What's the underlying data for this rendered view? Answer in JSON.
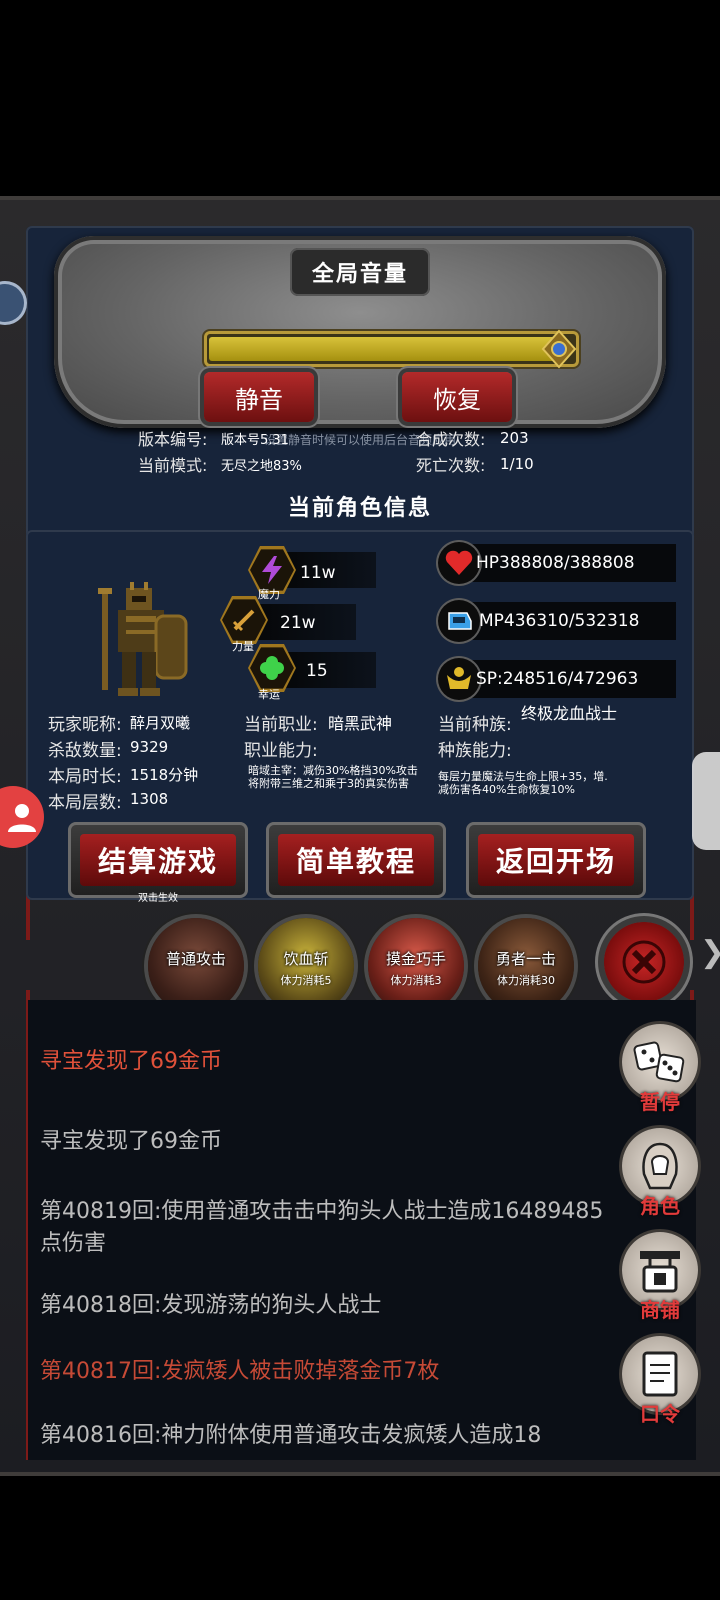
{
  "settings": {
    "title": "全局音量",
    "volume_level": 0.96,
    "mute_label": "静音",
    "restore_label": "恢复",
    "hint": "设置静音时候可以使用后台音频应用",
    "version_label": "版本编号:",
    "version_value": "版本号5.31",
    "mode_label": "当前模式:",
    "mode_value": "无尽之地83%",
    "synth_label": "合成次数:",
    "synth_value": "203",
    "death_label": "死亡次数:",
    "death_value": "1/10"
  },
  "character": {
    "title": "当前角色信息",
    "magic": {
      "value": "11w",
      "tag": "魔力",
      "icon": "lightning-icon"
    },
    "strength": {
      "value": "21w",
      "tag": "力量",
      "icon": "sword-icon"
    },
    "luck": {
      "value": "15",
      "tag": "幸运",
      "icon": "clover-icon"
    },
    "hp": "HP388808/388808",
    "mp": "MP436310/532318",
    "sp": "SP:248516/472963",
    "nickname_label": "玩家昵称:",
    "nickname": "醉月双曦",
    "kills_label": "杀敌数量:",
    "kills": "9329",
    "time_label": "本局时长:",
    "time": "1518分钟",
    "floor_label": "本局层数:",
    "floor": "1308",
    "job_label": "当前职业:",
    "job": "暗黑武神",
    "job_ability_label": "职业能力:",
    "job_ability": "暗域主宰：减伤30%格挡30%攻击将附带三维之和乘于3的真实伤害",
    "race_label": "当前种族:",
    "race": "终极龙血战士",
    "race_ability_label": "种族能力:",
    "race_ability": "每层力量魔法与生命上限+35，增.减伤害各40%生命恢复10%"
  },
  "actions": {
    "settle": "结算游戏",
    "settle_sub": "双击生效",
    "tutorial": "简单教程",
    "back": "返回开场"
  },
  "skills": [
    {
      "name": "普通攻击",
      "cost": ""
    },
    {
      "name": "饮血斩",
      "cost": "体力消耗5"
    },
    {
      "name": "摸金巧手",
      "cost": "体力消耗3"
    },
    {
      "name": "勇者一击",
      "cost": "体力消耗30"
    }
  ],
  "log": [
    {
      "text": "寻宝发现了69金币",
      "color": "#e0513a"
    },
    {
      "text": "寻宝发现了69金币",
      "color": "#bdbdbd"
    },
    {
      "text": "第40819回:使用普通攻击击中狗头人战士造成16489485点伤害",
      "color": "#bdbdbd"
    },
    {
      "text": "第40818回:发现游荡的狗头人战士",
      "color": "#bdbdbd"
    },
    {
      "text": "第40817回:发疯矮人被击败掉落金币7枚",
      "color": "#c64a36"
    },
    {
      "text": "第40816回:神力附体使用普通攻击发疯矮人造成18",
      "color": "#bdbdbd"
    }
  ],
  "side_menu": {
    "pause": "暂停",
    "character": "角色",
    "shop": "商铺",
    "code": "口令"
  },
  "colors": {
    "panel": "#17243a",
    "button_red": "#a52020",
    "volume_gold": "#d8c23a"
  }
}
